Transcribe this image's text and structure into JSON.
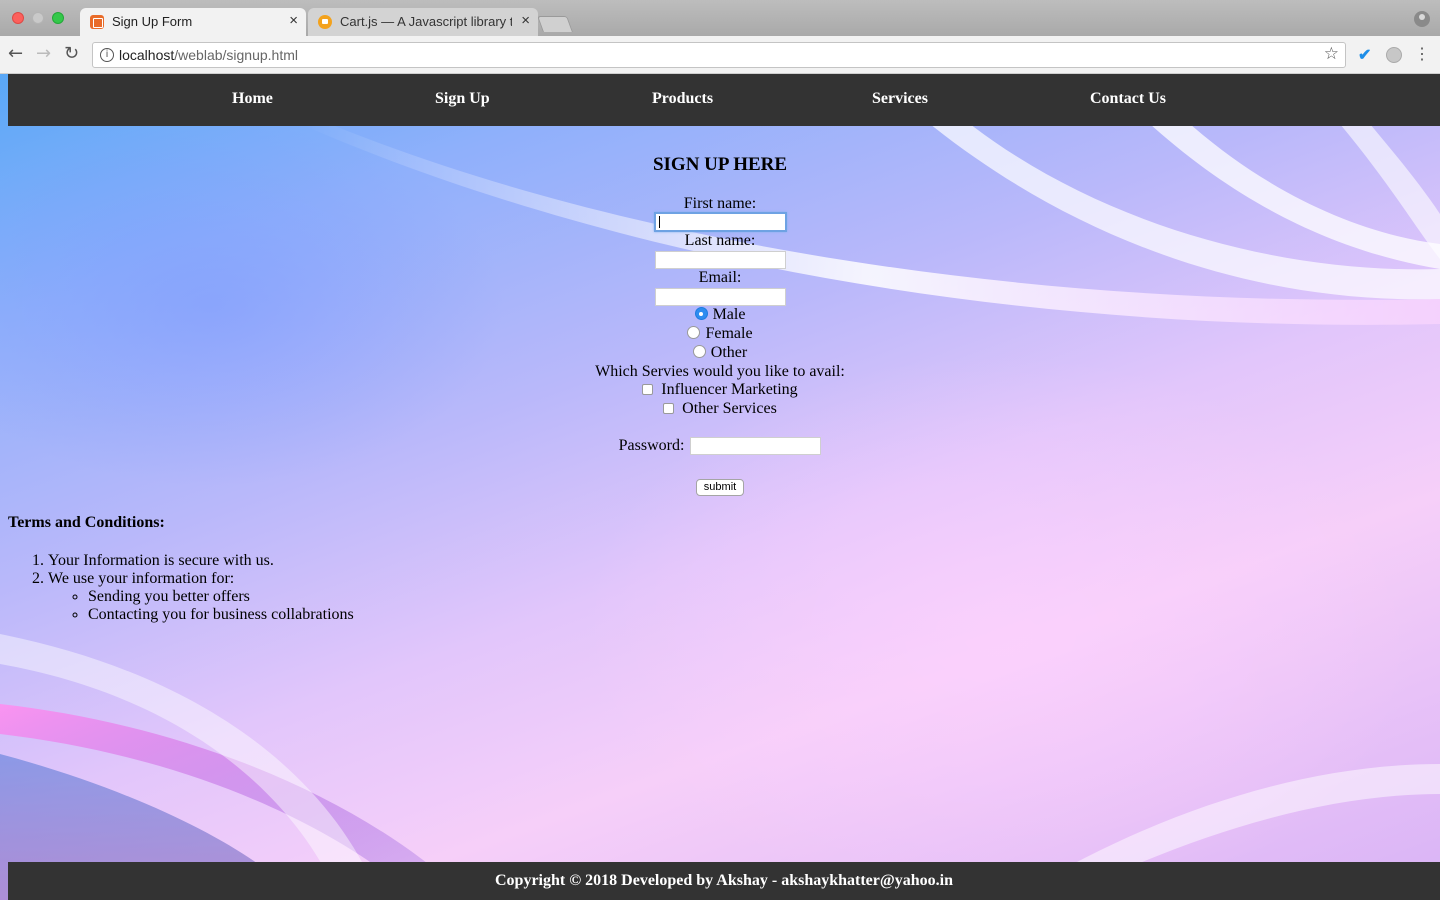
{
  "browser": {
    "tabs": [
      {
        "title": "Sign Up Form",
        "close": "×",
        "active": true
      },
      {
        "title": "Cart.js — A Javascript library t",
        "close": "×",
        "active": false
      }
    ],
    "url_host": "localhost",
    "url_path": "/weblab/signup.html",
    "info_glyph": "i",
    "star_glyph": "☆",
    "back_glyph": "←",
    "forward_glyph": "→",
    "reload_glyph": "↻",
    "check_glyph": "✔",
    "menu_glyph": "⋮"
  },
  "nav": {
    "items": [
      "Home",
      "Sign Up",
      "Products",
      "Services",
      "Contact Us"
    ]
  },
  "form": {
    "heading": "SIGN UP HERE",
    "first_name_label": "First name:",
    "last_name_label": "Last name:",
    "email_label": "Email:",
    "gender_options": [
      {
        "label": "Male",
        "checked": true
      },
      {
        "label": "Female",
        "checked": false
      },
      {
        "label": "Other",
        "checked": false
      }
    ],
    "services_label": "Which Servies would you like to avail:",
    "service_options": [
      "Influencer Marketing",
      "Other Services"
    ],
    "password_label": "Password:",
    "submit_label": "submit"
  },
  "terms": {
    "heading": "Terms and Conditions:",
    "items": [
      "Your Information is secure with us.",
      "We use your information for:"
    ],
    "sub_items": [
      "Sending you better offers",
      "Contacting you for business collabrations"
    ]
  },
  "footer": {
    "text": "Copyright © 2018 Developed by Akshay - akshaykhatter@yahoo.in"
  },
  "colors": {
    "nav_bg": "#333333",
    "footer_bg": "#333333",
    "radio_checked": "#2d8cf0",
    "focus_ring": "#6ea2e3"
  }
}
